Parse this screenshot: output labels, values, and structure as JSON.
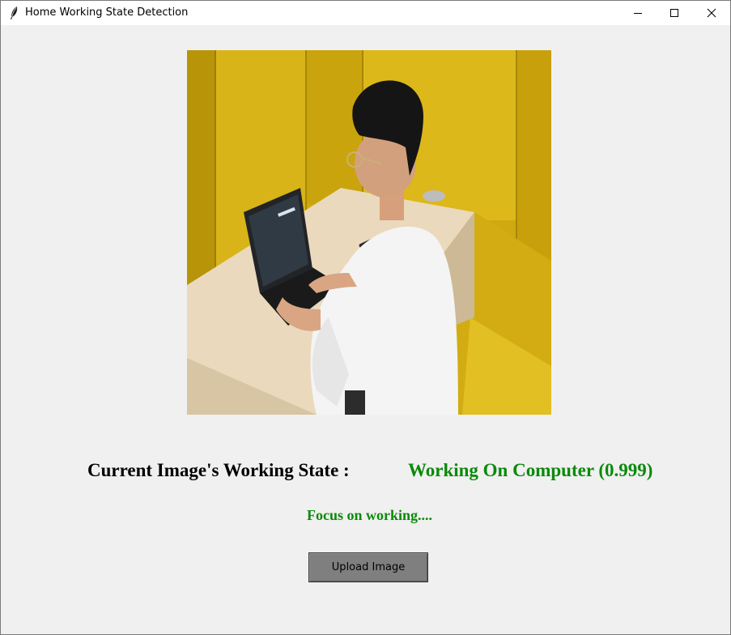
{
  "window": {
    "title": "Home Working State Detection",
    "controls": {
      "minimize_icon": "minimize-icon",
      "maximize_icon": "maximize-icon",
      "close_icon": "close-icon"
    }
  },
  "main": {
    "image": {
      "description_icon": "uploaded-photo"
    },
    "state_label": "Current Image's Working State :",
    "state_value": "Working On Computer (0.999)",
    "status_message": "Focus on working....",
    "upload_button_label": "Upload Image"
  },
  "colors": {
    "titlebar_bg": "#ffffff",
    "window_bg": "#f0f0f0",
    "result_green": "#0a8a0a",
    "button_gray": "#7f7f7f",
    "wall_yellow": "#d6b316",
    "desk_wood": "#e8d8bc"
  }
}
